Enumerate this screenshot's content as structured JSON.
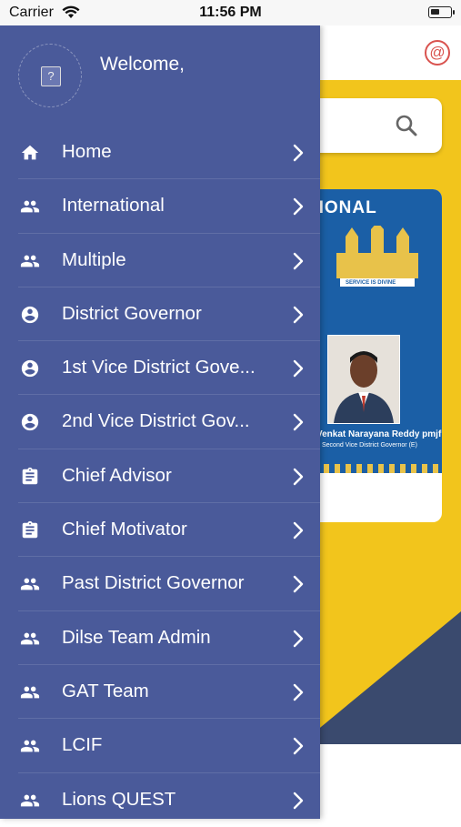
{
  "status_bar": {
    "carrier": "Carrier",
    "time": "11:56 PM",
    "battery_level_percent": 35
  },
  "drawer": {
    "welcome_text": "Welcome,",
    "avatar_placeholder": "?",
    "menu_items": [
      {
        "label": "Home",
        "icon": "home-icon"
      },
      {
        "label": "International",
        "icon": "people-icon"
      },
      {
        "label": "Multiple",
        "icon": "people-icon"
      },
      {
        "label": "District Governor",
        "icon": "account-circle-icon"
      },
      {
        "label": "1st Vice District Gove...",
        "icon": "account-circle-icon"
      },
      {
        "label": "2nd Vice District Gov...",
        "icon": "account-circle-icon"
      },
      {
        "label": "Chief Advisor",
        "icon": "clipboard-icon"
      },
      {
        "label": "Chief Motivator",
        "icon": "clipboard-icon"
      },
      {
        "label": "Past District Governor",
        "icon": "people-icon"
      },
      {
        "label": "Dilse Team Admin",
        "icon": "people-icon"
      },
      {
        "label": "GAT Team",
        "icon": "people-icon"
      },
      {
        "label": "LCIF",
        "icon": "people-icon"
      },
      {
        "label": "Lions QUEST",
        "icon": "people-icon"
      }
    ]
  },
  "background": {
    "at_symbol": "@",
    "poster_title": "TIONAL",
    "poster_church_text": "SERVICE IS DIVINE",
    "poster_name": "Venkat Narayana Reddy pmjf",
    "poster_role": "Second Vice District Governor (E)"
  },
  "colors": {
    "drawer_bg": "#4a5a9a",
    "bg_dark": "#3a4a6e",
    "bg_yellow": "#f2c51c",
    "accent_red": "#d9534f"
  }
}
